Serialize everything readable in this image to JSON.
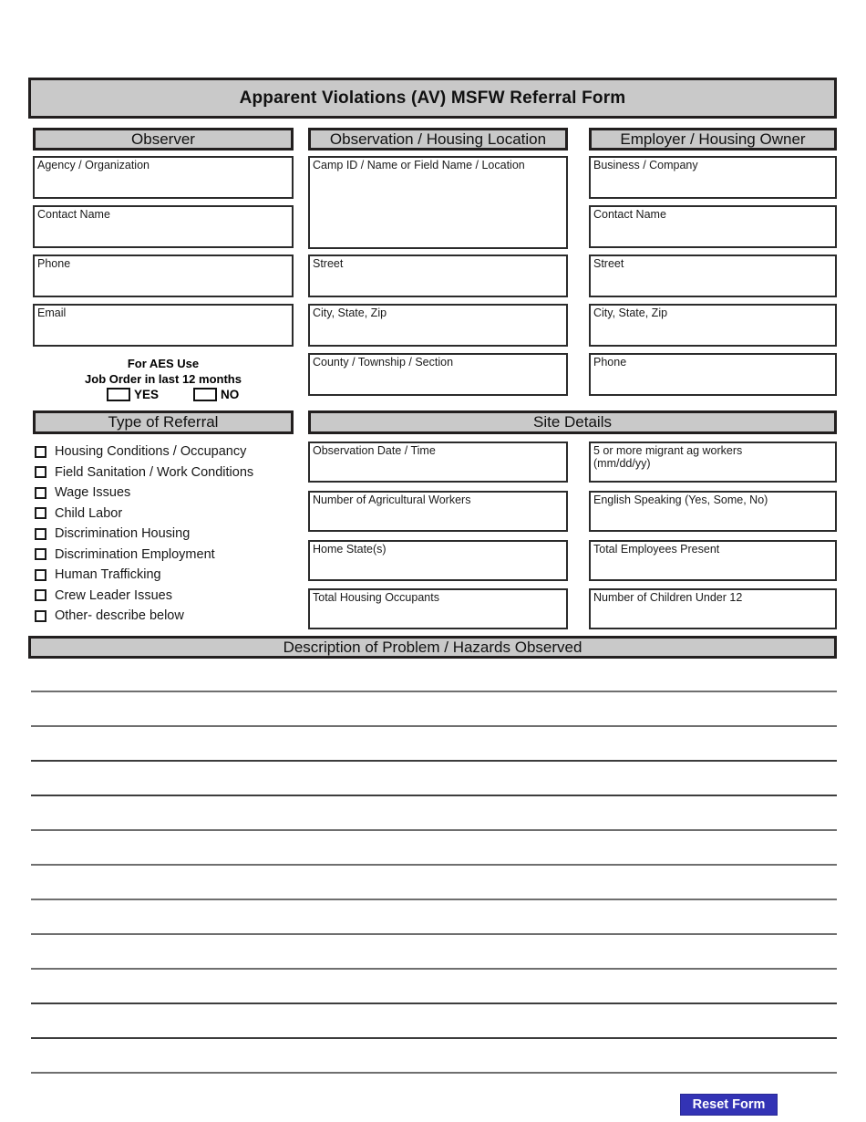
{
  "form": {
    "title": "Apparent Violations (AV) MSFW Referral Form"
  },
  "sections": {
    "observer": {
      "heading": "Observer"
    },
    "observation": {
      "heading": "Observation / Housing Location"
    },
    "employer": {
      "heading": "Employer / Housing Owner"
    },
    "referral": {
      "heading": "Type of Referral"
    },
    "site": {
      "heading": "Site Details"
    },
    "description": {
      "heading": "Description of Problem / Hazards Observed"
    }
  },
  "observer_fields": [
    {
      "label": "Agency / Organization",
      "value": ""
    },
    {
      "label": "Contact Name",
      "value": ""
    },
    {
      "label": "Phone",
      "value": ""
    },
    {
      "label": "Email",
      "value": ""
    }
  ],
  "observation_fields": [
    {
      "label": "Camp ID / Name or Field Name / Location",
      "value": ""
    },
    {
      "label": "Street",
      "value": ""
    },
    {
      "label": "City, State, Zip",
      "value": ""
    },
    {
      "label": "County / Township / Section",
      "value": ""
    }
  ],
  "employer_fields": [
    {
      "label": "Business / Company",
      "value": ""
    },
    {
      "label": "Contact Name",
      "value": ""
    },
    {
      "label": "Street",
      "value": ""
    },
    {
      "label": "City, State, Zip",
      "value": ""
    },
    {
      "label": "Phone",
      "value": ""
    }
  ],
  "aes": {
    "line1": "For AES Use",
    "line2": "Job Order in last 12 months",
    "yes_label": "YES",
    "no_label": "NO",
    "yes_checked": false,
    "no_checked": false
  },
  "referral_options": [
    {
      "label": "Housing Conditions / Occupancy",
      "checked": false
    },
    {
      "label": "Field Sanitation / Work Conditions",
      "checked": false
    },
    {
      "label": "Wage Issues",
      "checked": false
    },
    {
      "label": "Child Labor",
      "checked": false
    },
    {
      "label": "Discrimination Housing",
      "checked": false
    },
    {
      "label": "Discrimination Employment",
      "checked": false
    },
    {
      "label": "Human Trafficking",
      "checked": false
    },
    {
      "label": "Crew Leader Issues",
      "checked": false
    },
    {
      "label": "Other- describe below",
      "checked": false
    }
  ],
  "site_fields_left": [
    {
      "label": "Observation Date / Time",
      "value": ""
    },
    {
      "label": "Number of Agricultural Workers",
      "value": ""
    },
    {
      "label": "Home State(s)",
      "value": ""
    },
    {
      "label": "Total Housing Occupants",
      "value": ""
    }
  ],
  "site_fields_right": [
    {
      "label": "5 or more migrant ag workers\n (mm/dd/yy)",
      "value": ""
    },
    {
      "label": "English Speaking (Yes, Some, No)",
      "value": ""
    },
    {
      "label": "Total Employees Present",
      "value": ""
    },
    {
      "label": "Number of Children Under 12",
      "value": ""
    }
  ],
  "description_lines": 13,
  "buttons": {
    "reset_label": "Reset Form"
  },
  "colors": {
    "banner_fill": "#c9c9c9",
    "banner_border": "#221f1f",
    "field_border": "#2b2b2b",
    "rule": "#6f6f6f",
    "reset_bg": "#3333b5",
    "reset_text": "#ffffff"
  }
}
